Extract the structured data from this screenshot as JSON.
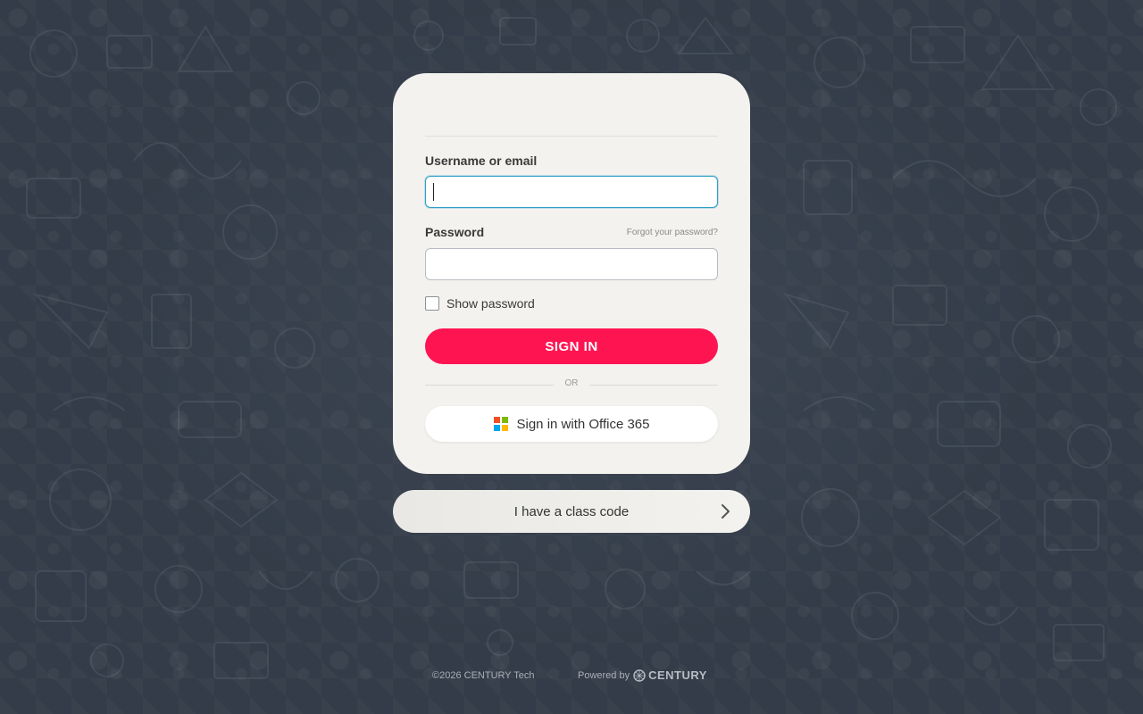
{
  "login": {
    "username_label": "Username or email",
    "username_value": "",
    "password_label": "Password",
    "password_value": "",
    "forgot_link": "Forgot your password?",
    "show_password_label": "Show password",
    "sign_in_label": "SIGN IN",
    "or_text": "OR",
    "office_label": "Sign in with Office 365"
  },
  "class_code": {
    "label": "I have a class code"
  },
  "footer": {
    "copyright": "©2026 CENTURY Tech",
    "powered_by": "Powered by",
    "brand": "CENTURY"
  },
  "colors": {
    "background": "#333c48",
    "card": "#f3f2ef",
    "primary_button": "#ff1452",
    "focus_border": "#2e9fc7",
    "ms_red": "#f25022",
    "ms_green": "#7fba00",
    "ms_blue": "#00a4ef",
    "ms_yellow": "#ffb900"
  },
  "icons": {
    "office": "microsoft-logo-icon",
    "class_code": "chevron-right-icon",
    "brand": "century-logo-icon"
  }
}
